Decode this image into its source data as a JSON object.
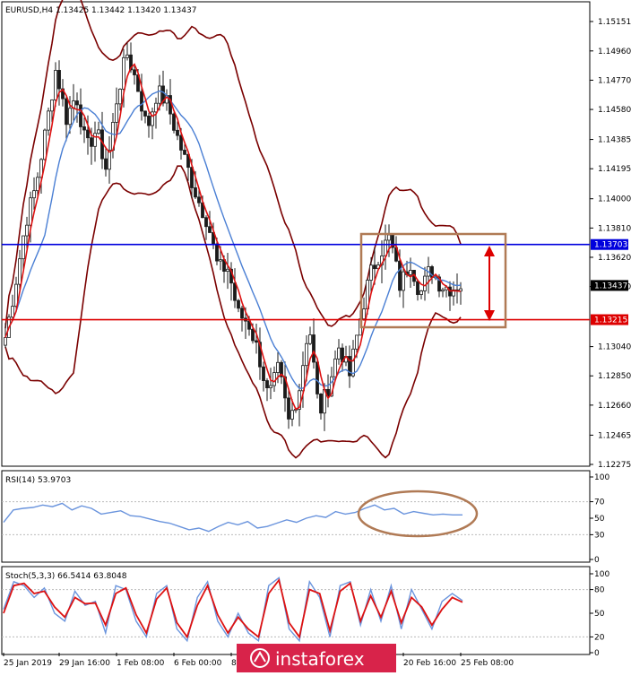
{
  "colors": {
    "background": "#ffffff",
    "candle": "#1a1a1a",
    "bollinger": "#7a0000",
    "ma_fast": "#dd1111",
    "ma_slow": "#4a7fd4",
    "resistance_line": "#0000dd",
    "support_line": "#dd0000",
    "annotation": "#b07a55",
    "arrow": "#dd0000",
    "rsi_line": "#6a94dd",
    "stoch_main": "#6a94dd",
    "stoch_signal": "#dd1111",
    "watermark_bg": "#d8234a",
    "label_blue_bg": "#0000dd",
    "label_red_bg": "#dd0000",
    "label_black_bg": "#000000"
  },
  "chart_data": [
    {
      "type": "candlestick",
      "symbol": "EURUSD",
      "timeframe": "H4",
      "title": "EURUSD,H4  1.13425 1.13442 1.13420 1.13437",
      "y_ticks": [
        "1.15151",
        "1.14960",
        "1.14770",
        "1.14580",
        "1.14385",
        "1.14195",
        "1.14000",
        "1.13810",
        "1.13620",
        "1.13430",
        "1.13040",
        "1.12850",
        "1.12660",
        "1.12465",
        "1.12275"
      ],
      "ylim": [
        1.12275,
        1.15151
      ],
      "x_tick_labels": [
        "25 Jan 2019",
        "29 Jan 16:00",
        "1 Feb 08:00",
        "6 Feb 00:00",
        "8",
        "20 Feb 16:00",
        "25 Feb 08:00"
      ],
      "last_price": 1.13437,
      "last_price_label": "1.13437",
      "levels": [
        {
          "name": "resistance",
          "value": 1.13703,
          "label": "1.13703",
          "color": "blue"
        },
        {
          "name": "support",
          "value": 1.13215,
          "label": "1.13215",
          "color": "red"
        }
      ],
      "annotations": [
        "consolidation-rectangle",
        "double-arrow"
      ],
      "close_path": [
        1.131,
        1.1345,
        1.1385,
        1.1408,
        1.1445,
        1.1485,
        1.1452,
        1.1468,
        1.1432,
        1.1445,
        1.1418,
        1.1465,
        1.1495,
        1.1475,
        1.1445,
        1.147,
        1.1462,
        1.144,
        1.142,
        1.14,
        1.1385,
        1.1355,
        1.1355,
        1.1325,
        1.132,
        1.13,
        1.127,
        1.129,
        1.1255,
        1.1275,
        1.132,
        1.126,
        1.128,
        1.1305,
        1.1285,
        1.132,
        1.135,
        1.1365,
        1.1375,
        1.1343,
        1.136,
        1.1338,
        1.1355,
        1.1344,
        1.1342,
        1.1344
      ]
    },
    {
      "type": "line",
      "title": "RSI(14) 53.9703",
      "y_ticks": [
        "100",
        "70",
        "50",
        "30",
        "0"
      ],
      "ylim": [
        0,
        100
      ],
      "series": [
        {
          "name": "RSI(14)",
          "values": [
            45,
            60,
            62,
            63,
            66,
            64,
            68,
            60,
            65,
            62,
            55,
            57,
            59,
            53,
            52,
            49,
            46,
            44,
            40,
            36,
            38,
            34,
            40,
            45,
            42,
            46,
            38,
            40,
            44,
            48,
            45,
            50,
            53,
            51,
            58,
            55,
            57,
            62,
            66,
            60,
            62,
            55,
            58,
            56,
            54,
            55,
            54,
            54
          ]
        }
      ],
      "annotations": [
        "ellipse"
      ]
    },
    {
      "type": "line",
      "title": "Stoch(5,3,3) 66.5414 63.8048",
      "y_ticks": [
        "100",
        "80",
        "50",
        "20",
        "0"
      ],
      "ylim": [
        0,
        100
      ],
      "series": [
        {
          "name": "main",
          "values": [
            55,
            90,
            85,
            70,
            82,
            50,
            40,
            78,
            60,
            65,
            25,
            85,
            80,
            40,
            20,
            75,
            85,
            30,
            15,
            70,
            90,
            40,
            20,
            50,
            25,
            15,
            85,
            95,
            30,
            15,
            90,
            70,
            20,
            85,
            90,
            35,
            80,
            40,
            85,
            30,
            80,
            55,
            30,
            65,
            75,
            66
          ]
        },
        {
          "name": "signal",
          "values": [
            50,
            85,
            88,
            75,
            78,
            58,
            45,
            70,
            62,
            63,
            35,
            75,
            82,
            48,
            25,
            68,
            82,
            38,
            20,
            60,
            85,
            48,
            25,
            45,
            30,
            20,
            75,
            92,
            38,
            20,
            80,
            75,
            28,
            78,
            88,
            40,
            72,
            45,
            78,
            38,
            70,
            58,
            35,
            55,
            70,
            64
          ]
        }
      ]
    }
  ],
  "main_header": "EURUSD,H4  1.13425 1.13442 1.13420 1.13437",
  "rsi_header": "RSI(14) 53.9703",
  "stoch_header": "Stoch(5,3,3) 66.5414 63.8048",
  "watermark": "instaforex"
}
